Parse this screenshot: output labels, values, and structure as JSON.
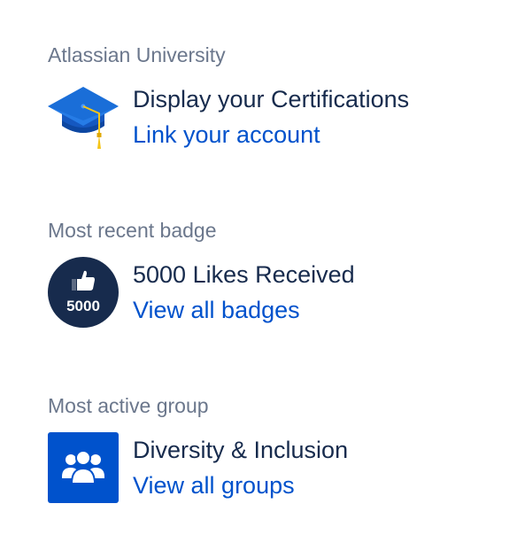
{
  "sections": [
    {
      "title": "Atlassian University",
      "primary": "Display your Certifications",
      "link": "Link your account",
      "icon": "graduation-cap-icon"
    },
    {
      "title": "Most recent badge",
      "primary": "5000 Likes Received",
      "link": "View all badges",
      "icon": "thumbs-up-badge-icon",
      "badge_number": "5000"
    },
    {
      "title": "Most active group",
      "primary": "Diversity & Inclusion",
      "link": "View all groups",
      "icon": "group-icon"
    }
  ],
  "colors": {
    "section_title": "#6b778c",
    "primary_text": "#172b4d",
    "link": "#0052cc",
    "badge_bg": "#172b4d",
    "group_bg": "#0052cc",
    "cap_blue": "#1a6ed8",
    "tassel": "#f5c518"
  }
}
